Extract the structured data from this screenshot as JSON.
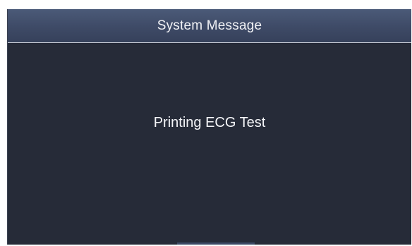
{
  "dialog": {
    "title": "System Message",
    "message": "Printing ECG Test"
  },
  "colors": {
    "title_bar": "#3e4a66",
    "body_background": "#262b38",
    "text": "#f4f5f8"
  }
}
